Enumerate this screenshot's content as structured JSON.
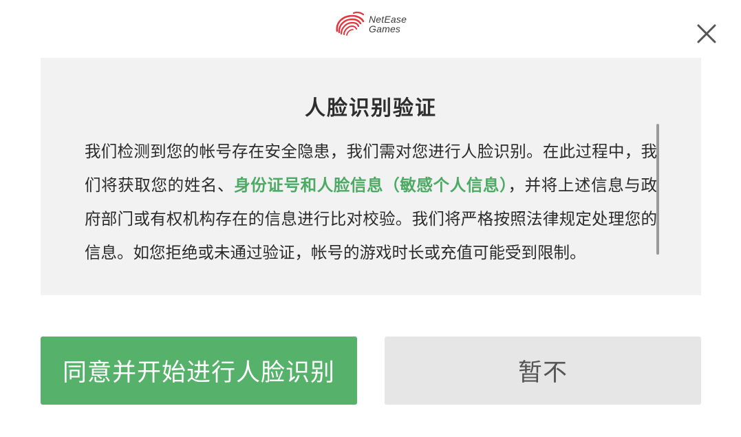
{
  "brand": {
    "name_line1": "NetEase",
    "name_line2": "Games",
    "logo_color": "#e2353d"
  },
  "dialog": {
    "title": "人脸识别验证",
    "body_before": "我们检测到您的帐号存在安全隐患，我们需对您进行人脸识别。在此过程中，我们将获取您的姓名、",
    "body_highlight": "身份证号和人脸信息（敏感个人信息）",
    "body_after": "，并将上述信息与政府部门或有权机构存在的信息进行比对校验。我们将严格按照法律规定处理您的信息。如您拒绝或未通过验证，帐号的游戏时长或充值可能受到限制。",
    "highlight_color": "#4caa64"
  },
  "buttons": {
    "agree_label": "同意并开始进行人脸识别",
    "later_label": "暂不"
  },
  "icons": {
    "close": "close-icon",
    "logo": "netease-logo-icon"
  },
  "colors": {
    "primary": "#56b16b",
    "secondary": "#e6e6e6",
    "panel": "#f2f2f2"
  }
}
